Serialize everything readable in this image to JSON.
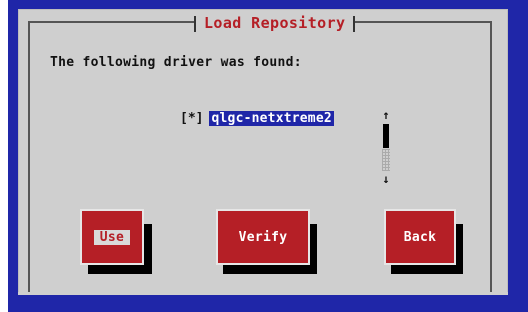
{
  "dialog": {
    "title": "Load Repository",
    "message": "The following driver was found:",
    "driver": {
      "checkbox": "[*]",
      "name": "qlgc-netxtreme2"
    },
    "scrollbar": {
      "up": "↑",
      "down": "↓"
    },
    "buttons": {
      "use": "Use",
      "verify": "Verify",
      "back": "Back"
    }
  },
  "colors": {
    "background_blue": "#1f26a8",
    "dialog_gray": "#cfcfcf",
    "title_red": "#b51f26",
    "button_red": "#b51f26",
    "selection_blue": "#1f26a8"
  }
}
